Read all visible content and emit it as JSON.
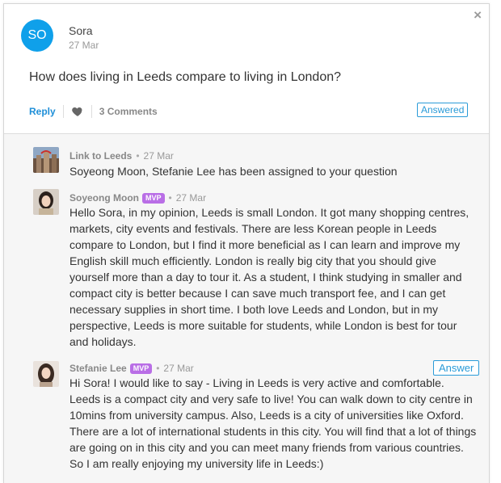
{
  "post": {
    "avatar_initials": "SO",
    "author": "Sora",
    "date": "27 Mar",
    "question": "How does living in Leeds compare to living in London?",
    "actions": {
      "reply_label": "Reply",
      "comments_label": "3 Comments",
      "status_badge": "Answered"
    },
    "close_icon": "×"
  },
  "comments": [
    {
      "author": "Link to Leeds",
      "date": "27 Mar",
      "mvp": "",
      "text": "Soyeong Moon, Stefanie Lee has been assigned to your question"
    },
    {
      "author": "Soyeong Moon",
      "mvp": "MVP",
      "date": "27 Mar",
      "text": "Hello Sora, in my opinion, Leeds is small London. It got many shopping centres, markets, city events and festivals. There are less Korean people in Leeds compare to London, but I find it more beneficial as I can learn and improve my English skill much efficiently. London is really big city that you should give yourself more than a day to tour it. As a student, I think studying in smaller and compact city is better because I can save much transport fee, and I can get necessary supplies in short time. I both love Leeds and London, but in my perspective, Leeds is more suitable for students, while London is best for tour and holidays."
    },
    {
      "author": "Stefanie Lee",
      "mvp": "MVP",
      "date": "27 Mar",
      "answer_label": "Answer",
      "text": "Hi Sora! I would like to say - Living in Leeds is very active and comfortable. Leeds is a compact city and very safe to live! You can walk down to city centre in 10mins from university campus. Also, Leeds is a city of universities like Oxford. There are a lot of international students in this city. You will find that a lot of things are going on in this city and you can meet many friends from various countries. So I am really enjoying my university life in Leeds:)"
    }
  ],
  "colors": {
    "accent": "#0fa0ea",
    "link": "#1f8fd8",
    "mvp_badge": "#b96ee6",
    "comments_bg": "#f6f6f6"
  },
  "icons": [
    "close-icon",
    "heart-icon"
  ]
}
